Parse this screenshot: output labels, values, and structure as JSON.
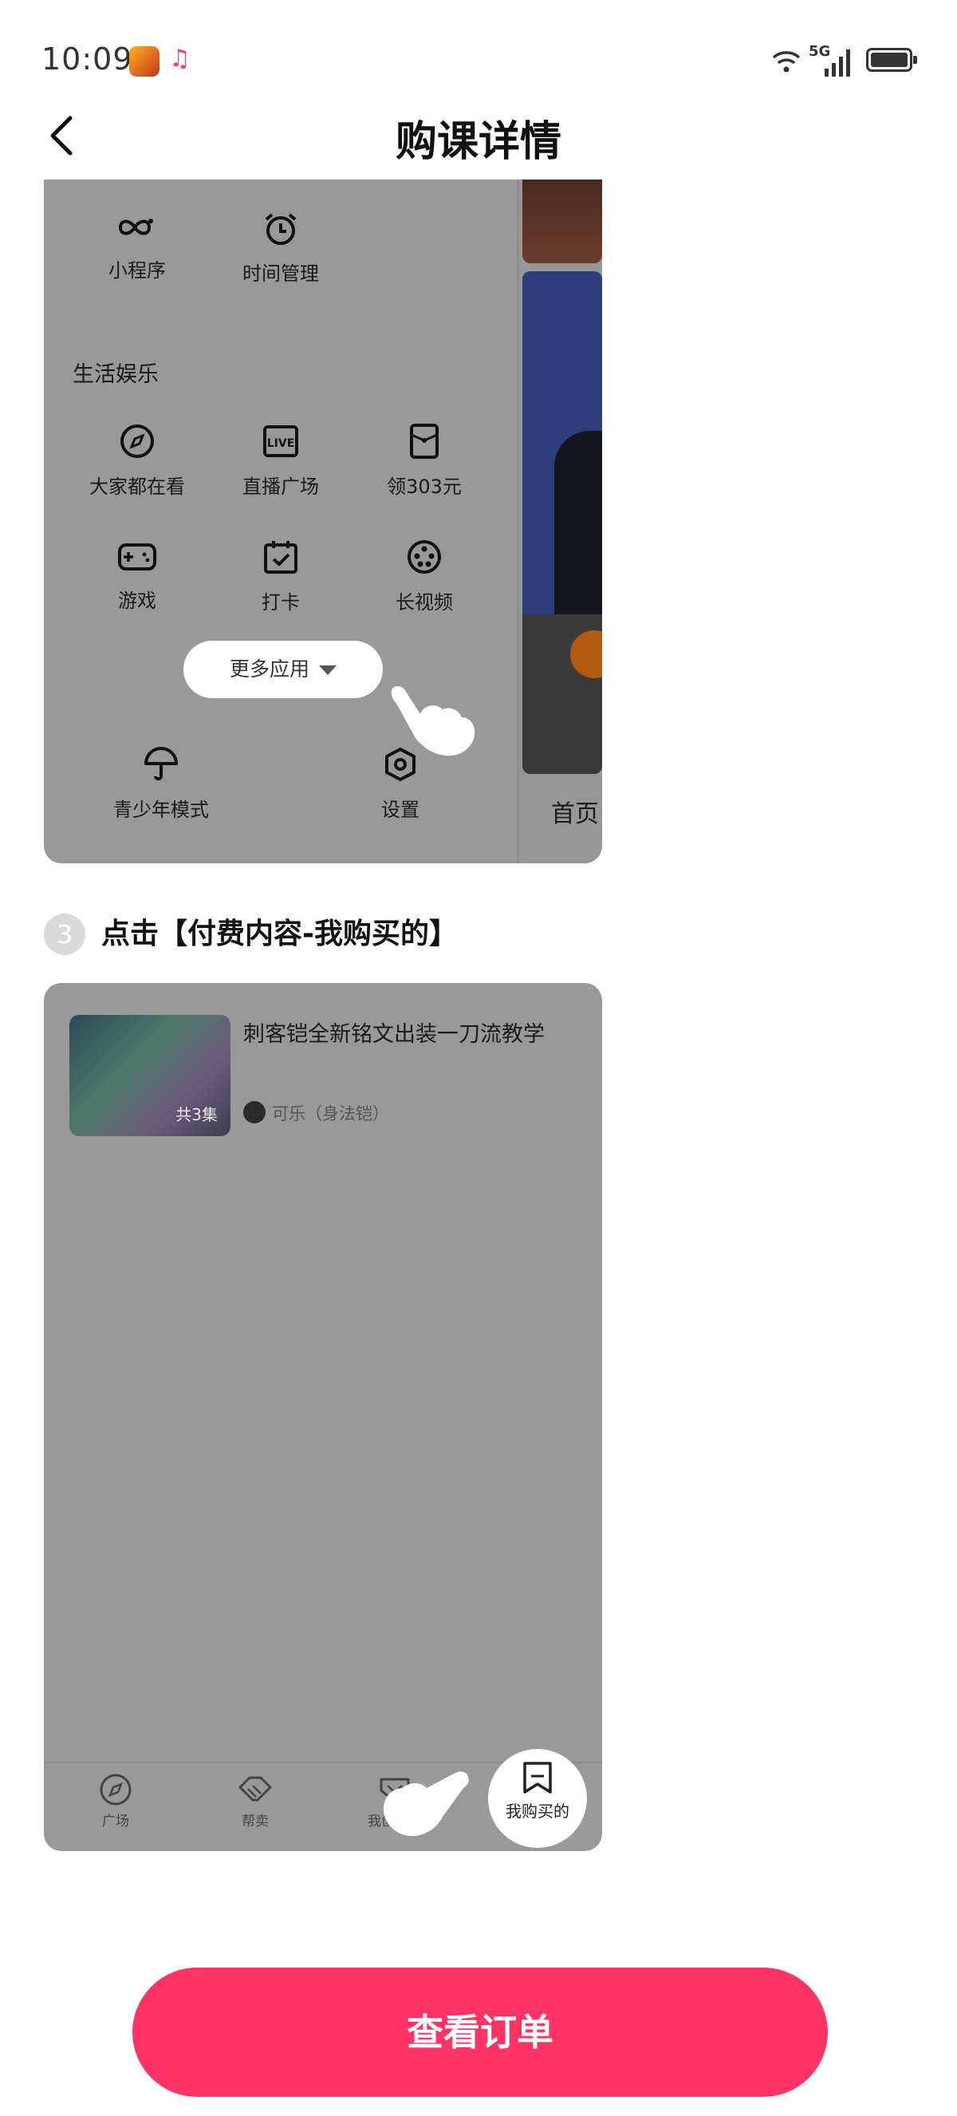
{
  "status_bar": {
    "time": "10:09",
    "network": "5G"
  },
  "header": {
    "title": "购课详情"
  },
  "step2_screenshot": {
    "top_items": [
      {
        "icon": "mini-program-icon",
        "label": "小程序"
      },
      {
        "icon": "alarm-clock-icon",
        "label": "时间管理"
      }
    ],
    "section_title": "生活娱乐",
    "life_items": [
      {
        "icon": "compass-icon",
        "label": "大家都在看"
      },
      {
        "icon": "live-icon",
        "label": "直播广场"
      },
      {
        "icon": "red-packet-icon",
        "label": "领303元"
      },
      {
        "icon": "gamepad-icon",
        "label": "游戏"
      },
      {
        "icon": "calendar-check-icon",
        "label": "打卡"
      },
      {
        "icon": "film-reel-icon",
        "label": "长视频"
      }
    ],
    "more_apps": "更多应用",
    "bottom_items": [
      {
        "icon": "umbrella-icon",
        "label": "青少年模式"
      },
      {
        "icon": "settings-hexagon-icon",
        "label": "设置"
      }
    ],
    "side_tab": "首页"
  },
  "step3": {
    "number": "3",
    "text": "点击【付费内容-我购买的】"
  },
  "step3_screenshot": {
    "course": {
      "title": "刺客铠全新铭文出装一刀流教学",
      "episodes": "共3集",
      "author": "可乐（身法铠）"
    },
    "tabs": [
      {
        "icon": "compass-icon",
        "label": "广场"
      },
      {
        "icon": "handshake-icon",
        "label": "帮卖"
      },
      {
        "icon": "heart-box-icon",
        "label": "我创建的"
      }
    ],
    "bought": {
      "icon": "bookmark-icon",
      "label": "我购买的"
    }
  },
  "footer": {
    "order_button": "查看订单"
  },
  "colors": {
    "accent": "#ff3465",
    "overlay": "#999999"
  }
}
